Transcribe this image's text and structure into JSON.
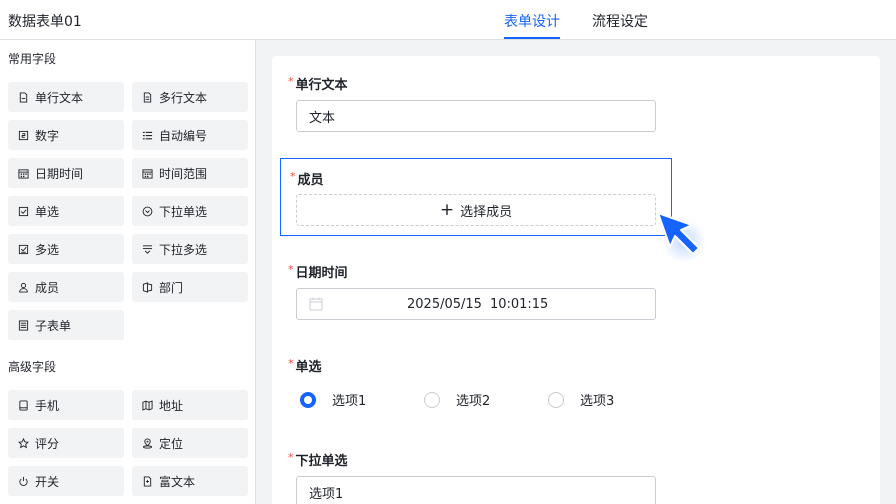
{
  "header": {
    "title": "数据表单01",
    "tabs": [
      {
        "label": "表单设计",
        "active": true
      },
      {
        "label": "流程设定",
        "active": false
      }
    ]
  },
  "sidebar": {
    "common_title": "常用字段",
    "common": [
      {
        "label": "单行文本",
        "icon": "single-line-text-icon"
      },
      {
        "label": "多行文本",
        "icon": "multi-line-text-icon"
      },
      {
        "label": "数字",
        "icon": "number-icon"
      },
      {
        "label": "自动编号",
        "icon": "auto-number-icon"
      },
      {
        "label": "日期时间",
        "icon": "calendar-icon"
      },
      {
        "label": "时间范围",
        "icon": "time-range-icon"
      },
      {
        "label": "单选",
        "icon": "checkbox-icon"
      },
      {
        "label": "下拉单选",
        "icon": "dropdown-single-icon"
      },
      {
        "label": "多选",
        "icon": "multi-select-icon"
      },
      {
        "label": "下拉多选",
        "icon": "dropdown-multi-icon"
      },
      {
        "label": "成员",
        "icon": "user-icon"
      },
      {
        "label": "部门",
        "icon": "department-icon"
      },
      {
        "label": "子表单",
        "icon": "sub-form-icon"
      }
    ],
    "advanced_title": "高级字段",
    "advanced": [
      {
        "label": "手机",
        "icon": "phone-icon"
      },
      {
        "label": "地址",
        "icon": "map-icon"
      },
      {
        "label": "评分",
        "icon": "star-icon"
      },
      {
        "label": "定位",
        "icon": "location-icon"
      },
      {
        "label": "开关",
        "icon": "power-icon"
      },
      {
        "label": "富文本",
        "icon": "rich-text-icon"
      }
    ]
  },
  "form": {
    "required_mark": "*",
    "single_text": {
      "label": "单行文本",
      "value": "文本"
    },
    "member": {
      "label": "成员",
      "button": "选择成员",
      "plus": "+"
    },
    "datetime": {
      "label": "日期时间",
      "date": "2025/05/15",
      "time": "10:01:15"
    },
    "radio": {
      "label": "单选",
      "options": [
        "选项1",
        "选项2",
        "选项3"
      ],
      "selected": 0
    },
    "dropdown": {
      "label": "下拉单选",
      "value": "选项1"
    }
  },
  "colors": {
    "accent": "#1664ff",
    "required": "#f54a45"
  }
}
